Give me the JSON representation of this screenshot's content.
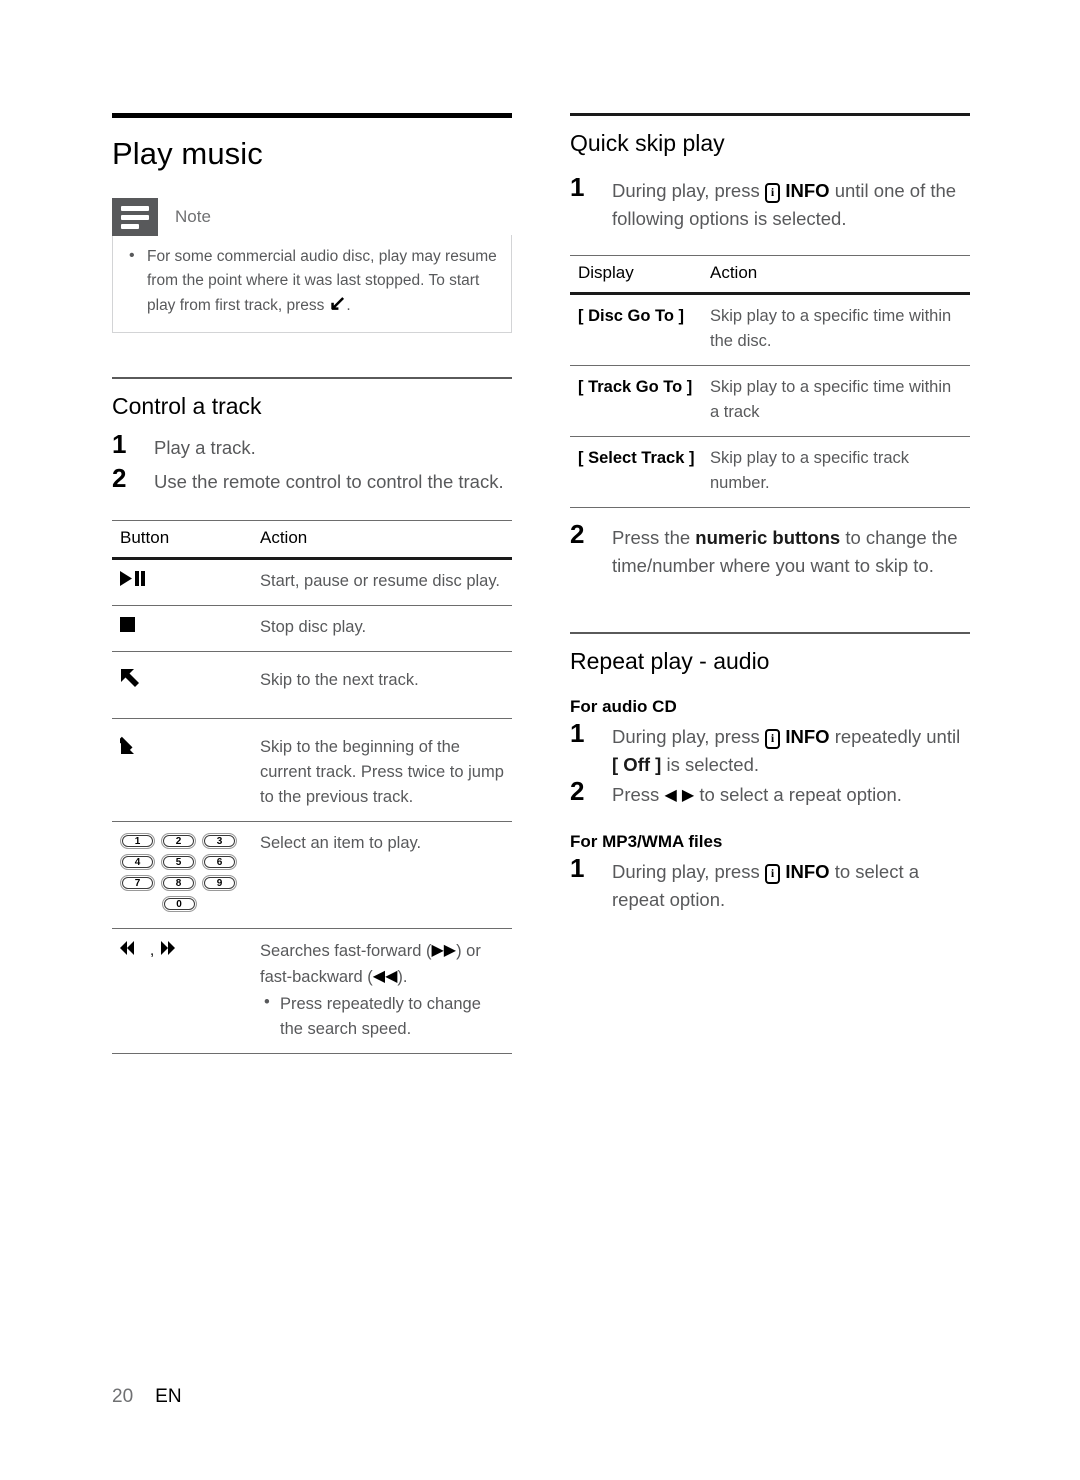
{
  "document": {
    "footer": {
      "page_number": "20",
      "language": "EN"
    }
  },
  "left_column": {
    "chapter_title": "Play music",
    "note": {
      "icon": "note-icon",
      "title": "Note",
      "items": [
        "For some commercial audio disc, play may resume from the point where it was last stopped. To start play from first track, press"
      ],
      "item_trailing_glyph": "↙",
      "item_trailing_period": "."
    },
    "control_track": {
      "heading": "Control a track",
      "steps": [
        {
          "num": "1",
          "text": "Play a track."
        },
        {
          "num": "2",
          "text": "Use the remote control to control the track."
        }
      ],
      "table": {
        "headers": [
          "Button",
          "Action"
        ],
        "rows": [
          {
            "icon": "play-pause-icon",
            "glyph": "▶▐▐",
            "action": "Start, pause or resume disc play."
          },
          {
            "icon": "stop-icon",
            "glyph": "■",
            "action": "Stop disc play."
          },
          {
            "icon": "skip-next-icon",
            "glyph": "↖",
            "action": "Skip to the next track."
          },
          {
            "icon": "skip-previous-icon",
            "glyph": "↙",
            "action": "Skip to the beginning of the current track. Press twice to jump to the previous track."
          },
          {
            "icon": "numeric-keypad-icon",
            "keys": [
              "1",
              "2",
              "3",
              "4",
              "5",
              "6",
              "7",
              "8",
              "9",
              "0"
            ],
            "action": "Select an item to play."
          },
          {
            "icon": "search-icon",
            "glyph_rew": "◀◀",
            "glyph_sep": ", ",
            "glyph_ff": "▶▶",
            "action_line1_a": "Searches fast-forward (",
            "action_line1_glyph": "▶▶",
            "action_line1_b": ") or fast-backward (",
            "action_line1_glyph2": "◀◀",
            "action_line1_c": ").",
            "bullet": "Press repeatedly to change the search speed."
          }
        ]
      }
    }
  },
  "right_column": {
    "quick_skip": {
      "heading": "Quick skip play",
      "step1": {
        "num": "1",
        "text_before": "During play, press",
        "info_key": "i",
        "info_label": "INFO",
        "text_after": "until one of the following options is selected."
      },
      "table": {
        "headers": [
          "Display",
          "Action"
        ],
        "rows": [
          {
            "display": "[ Disc Go To ]",
            "action": "Skip play to a specific time within the disc."
          },
          {
            "display": "[ Track Go To ]",
            "action": "Skip play to a specific time within a track"
          },
          {
            "display": "[ Select Track ]",
            "action": "Skip play to a specific track number."
          }
        ]
      },
      "step2": {
        "num": "2",
        "text_before": "Press the",
        "bold": "numeric buttons",
        "text_after": "to change the time/number where you want to skip to."
      }
    },
    "repeat_play": {
      "heading": "Repeat play - audio",
      "audio_cd": {
        "subheading": "For audio CD",
        "step1": {
          "num": "1",
          "text_before": "During play, press",
          "info_key": "i",
          "info_label": "INFO",
          "text_mid": "repeatedly until",
          "bold_option": "[ Off ]",
          "text_after": "is selected."
        },
        "step2": {
          "num": "2",
          "text_before": "Press",
          "glyph_left": "◀",
          "glyph_right": "▶",
          "text_after": "to select a repeat option."
        }
      },
      "mp3_wma": {
        "subheading": "For MP3/WMA files",
        "step1": {
          "num": "1",
          "text_before": "During play, press",
          "info_key": "i",
          "info_label": "INFO",
          "text_after": "to select a repeat option."
        }
      }
    }
  }
}
